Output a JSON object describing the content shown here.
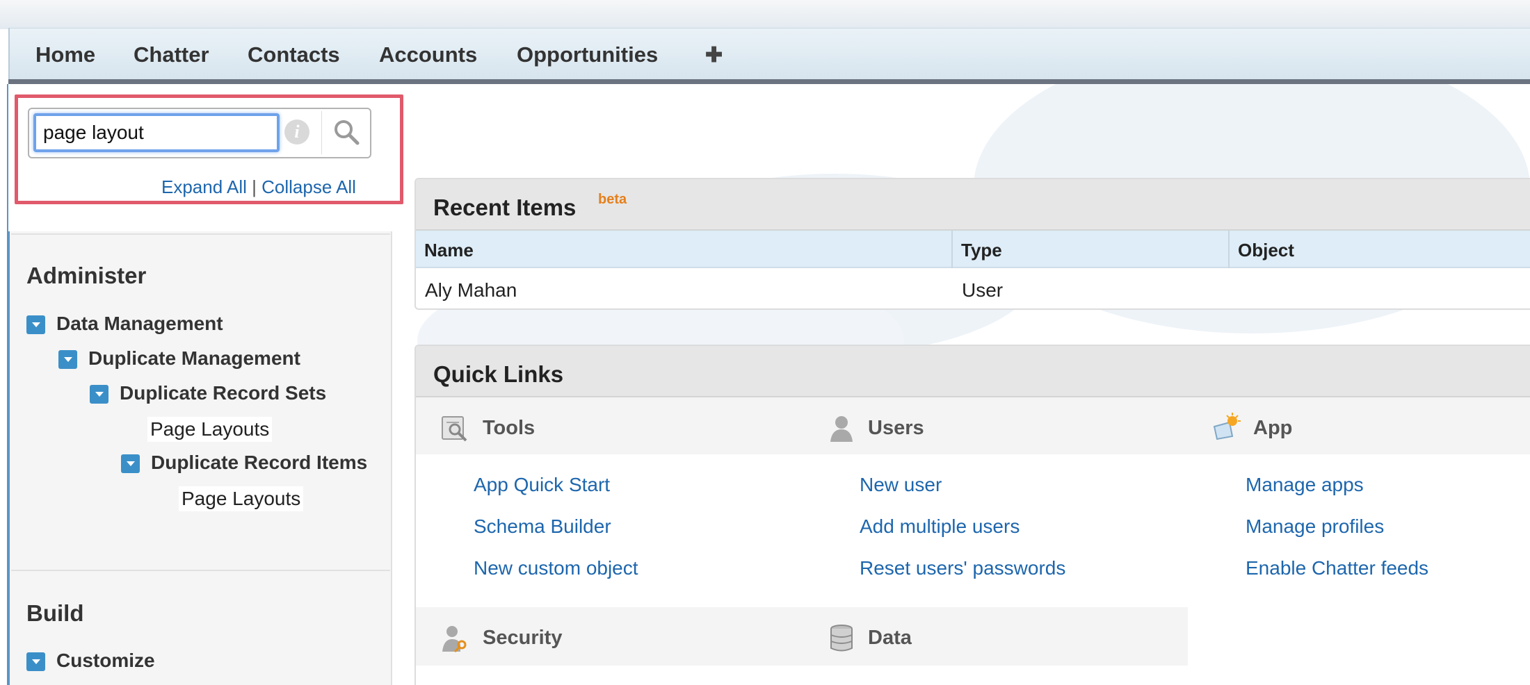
{
  "nav": {
    "tabs": [
      "Home",
      "Chatter",
      "Contacts",
      "Accounts",
      "Opportunities"
    ],
    "plus_glyph": "✚"
  },
  "sidebar": {
    "search": {
      "value": "page layout",
      "info_icon_glyph": "i"
    },
    "expand_all": "Expand All",
    "separator": "|",
    "collapse_all": "Collapse All",
    "sections": [
      {
        "title": "Administer",
        "items": [
          {
            "label": "Data Management",
            "level": 0,
            "expanded": true
          },
          {
            "label": "Duplicate Management",
            "level": 1,
            "expanded": true
          },
          {
            "label": "Duplicate Record Sets",
            "level": 2,
            "expanded": true
          },
          {
            "label": "Page Layouts",
            "level": 3,
            "leaf": true
          },
          {
            "label": "Duplicate Record Items",
            "level": 3,
            "expanded": true
          },
          {
            "label": "Page Layouts",
            "level": 4,
            "leaf": true
          }
        ]
      },
      {
        "title": "Build",
        "items": [
          {
            "label": "Customize",
            "level": 0,
            "expanded": true
          }
        ]
      }
    ]
  },
  "recent_items": {
    "title": "Recent Items",
    "badge": "beta",
    "columns": [
      "Name",
      "Type",
      "Object"
    ],
    "rows": [
      {
        "name": "Aly Mahan",
        "type": "User",
        "object": ""
      }
    ]
  },
  "quick_links": {
    "title": "Quick Links",
    "categories": [
      {
        "name": "Tools",
        "icon": "tools-icon",
        "links": [
          "App Quick Start",
          "Schema Builder",
          "New custom object"
        ]
      },
      {
        "name": "Users",
        "icon": "user-icon",
        "links": [
          "New user",
          "Add multiple users",
          "Reset users' passwords"
        ]
      },
      {
        "name": "App",
        "icon": "app-icon",
        "links": [
          "Manage apps",
          "Manage profiles",
          "Enable Chatter feeds"
        ]
      },
      {
        "name": "Security",
        "icon": "security-icon",
        "links": []
      },
      {
        "name": "Data",
        "icon": "data-icon",
        "links": []
      }
    ]
  },
  "colors": {
    "link": "#1d66ad",
    "highlight_border": "#e05a6b",
    "toggle": "#3b8fc8",
    "beta": "#e5801c"
  }
}
